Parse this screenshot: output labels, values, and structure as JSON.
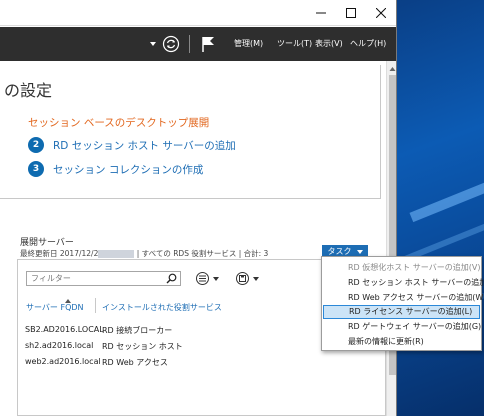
{
  "toolbar": {
    "menu": [
      "管理(M)",
      "ツール(T)",
      "表示(V)",
      "ヘルプ(H)"
    ],
    "icons": [
      "refresh-icon",
      "notification-flag-icon"
    ]
  },
  "quick_start": {
    "heading": "の設定",
    "scenario_title": "セッション ベースのデスクトップ展開",
    "steps": [
      {
        "num": "2",
        "label": "RD セッション ホスト サーバーの追加"
      },
      {
        "num": "3",
        "label": "セッション コレクションの作成"
      }
    ]
  },
  "deployment_servers": {
    "title": "展開サーバー",
    "last_updated_prefix": "最終更新日 2017/12/2",
    "summary": "| すべての RDS 役割サービス | 合計: 3",
    "tasks_label": "タスク",
    "filter_placeholder": "フィルター",
    "columns": [
      "サーバー FQDN",
      "インストールされた役割サービス"
    ],
    "rows": [
      {
        "fqdn": "SB2.AD2016.LOCAL",
        "role": "RD 接続ブローカー"
      },
      {
        "fqdn": "sh2.ad2016.local",
        "role": "RD セッション ホスト"
      },
      {
        "fqdn": "web2.ad2016.local",
        "role": "RD Web アクセス"
      }
    ]
  },
  "tasks_menu": {
    "items": [
      {
        "label": "RD 仮想化ホスト サーバーの追加(V)",
        "state": "disabled"
      },
      {
        "label": "RD セッション ホスト サーバーの追加(S)",
        "state": "enabled"
      },
      {
        "label": "RD Web アクセス サーバーの追加(W)",
        "state": "enabled"
      },
      {
        "label": "RD ライセンス サーバーの追加(L)",
        "state": "selected"
      },
      {
        "label": "RD ゲートウェイ サーバーの追加(G)",
        "state": "enabled"
      },
      {
        "label": "最新の情報に更新(R)",
        "state": "enabled"
      }
    ]
  },
  "colors": {
    "toolbar_bg": "#2e2e2e",
    "accent_blue": "#1d6db4",
    "scenario_orange": "#e2661d",
    "selected_item_bg": "#cce4f7"
  }
}
